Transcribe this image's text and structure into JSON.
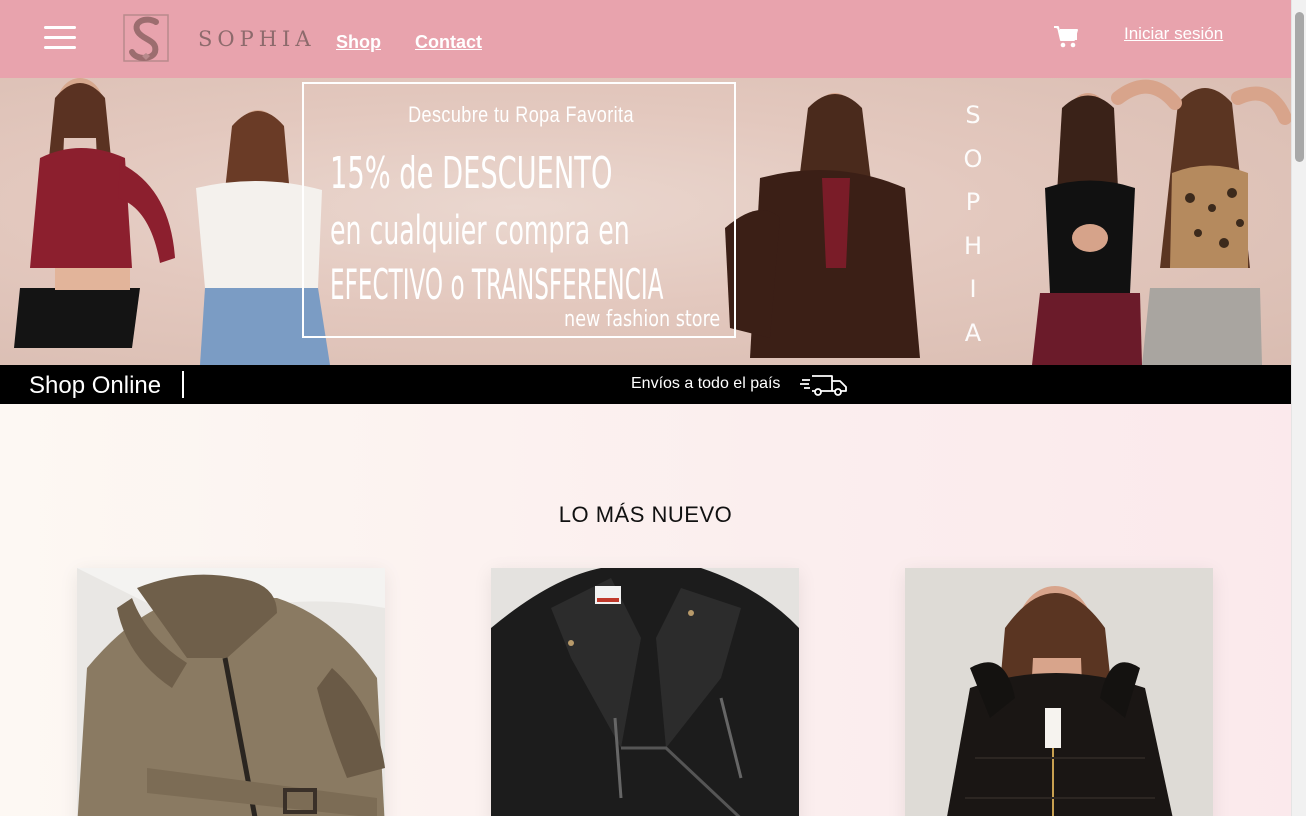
{
  "header": {
    "brand": "SOPHIA",
    "nav": [
      {
        "label": "Shop"
      },
      {
        "label": "Contact"
      }
    ],
    "login_label": "Iniciar sesión",
    "background_color": "#e8a3ad"
  },
  "banner": {
    "subtitle": "Descubre tu Ropa Favorita",
    "line1": "15% de DESCUENTO",
    "line2": "en cualquier compra en",
    "line3": "EFECTIVO o TRANSFERENCIA",
    "tagline": "new fashion store",
    "vertical_brand": [
      "S",
      "O",
      "P",
      "H",
      "I",
      "A"
    ]
  },
  "strip": {
    "title": "Shop Online",
    "shipping": "Envíos a todo el país"
  },
  "section": {
    "title": "LO MÁS NUEVO"
  },
  "products": [
    {
      "icon": "jacket-olive-image"
    },
    {
      "icon": "jacket-black-leather-image"
    },
    {
      "icon": "model-puffer-jacket-image"
    }
  ]
}
